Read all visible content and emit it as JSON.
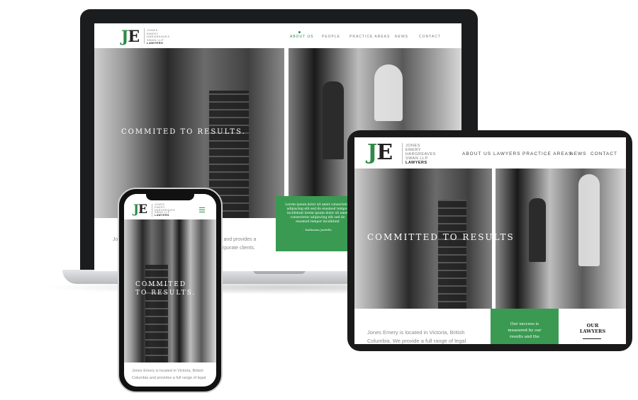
{
  "colors": {
    "brand_green": "#2e8b47",
    "card_green": "#3a9a52",
    "bezel": "#1b1c1e"
  },
  "logo": {
    "monogram_j": "J",
    "monogram_e": "E",
    "lines": [
      "JONES",
      "EMERY",
      "HARGREAVES",
      "SWAN LLP"
    ],
    "tagline": "LAWYERS"
  },
  "laptop": {
    "nav": [
      "ABOUT US",
      "PEOPLE",
      "PRACTICE AREAS",
      "NEWS",
      "CONTACT"
    ],
    "hero_text": "COMMITED TO RESULTS.",
    "card_text": "Lorem ipsum dolor sit amet consectetur adipiscing elit sed do eiusmod tempor incididunt lorem ipsum dolor sit amet consectetur adipiscing elit sed do eiusmod tempor incididunt",
    "card_author": "- Katharina Jardello",
    "body_left": "Jon",
    "body_line1": "s and provides a",
    "body_line2": "orporate clients."
  },
  "tablet": {
    "nav": [
      "ABOUT US",
      "LAWYERS",
      "PRACTICE AREAS",
      "NEWS",
      "CONTACT"
    ],
    "hero_text": "COMMITTED TO RESULTS",
    "body_line1": "Jones Emery is located in Victoria, British",
    "body_line2": "Columbia. We provide a full range of legal",
    "card_line1": "Our success is",
    "card_line2": "measured by our",
    "card_line3": "results and the",
    "side_title_1": "OUR",
    "side_title_2": "LAWYERS"
  },
  "phone": {
    "hero_line1": "COMMITED",
    "hero_line2": "TO RESULTS.",
    "body_line1": "Jones Emery is located in Victoria, British",
    "body_line2": "Columbia and provides a full range of legal"
  }
}
